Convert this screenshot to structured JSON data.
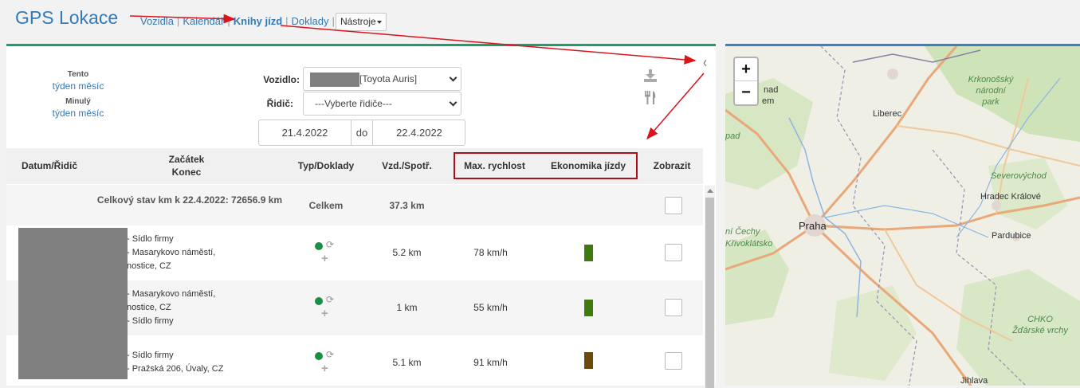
{
  "app": {
    "title": "GPS Lokace"
  },
  "nav": {
    "items": [
      {
        "label": "Vozidla"
      },
      {
        "label": "Kalendář"
      },
      {
        "label": "Knihy jízd"
      },
      {
        "label": "Doklady"
      }
    ],
    "tools_label": "Nástroje"
  },
  "period": {
    "this_label": "Tento",
    "this_links": "týden měsíc",
    "last_label": "Minulý",
    "last_links": "týden měsíc"
  },
  "filters": {
    "vehicle_label": "Vozidlo:",
    "vehicle_value": "[Toyota Auris]",
    "driver_label": "Řidič:",
    "driver_placeholder": "---Vyberte řidiče---",
    "date_from": "21.4.2022",
    "date_sep": "do",
    "date_to": "22.4.2022"
  },
  "table": {
    "headers": {
      "date_driver": "Datum/Řidič",
      "start": "Začátek",
      "end": "Konec",
      "type": "Typ/Doklady",
      "dist": "Vzd./Spotř.",
      "max_speed": "Max. rychlost",
      "economy": "Ekonomika jízdy",
      "show": "Zobrazit"
    },
    "summary": {
      "text": "Celkový stav km k 22.4.2022: 72656.9 km",
      "type": "Celkem",
      "dist": "37.3 km"
    },
    "rows": [
      {
        "addr1": "- Sídlo firmy",
        "addr2": "- Masarykovo náměstí,",
        "addr3": "nostice, CZ",
        "dist": "5.2 km",
        "speed": "78 km/h",
        "econ_color": "#3e7a0f"
      },
      {
        "addr1": "- Masarykovo náměstí,",
        "addr2": "nostice, CZ",
        "addr3": "- Sídlo firmy",
        "dist": "1 km",
        "speed": "55 km/h",
        "econ_color": "#3e7a0f"
      },
      {
        "addr1": "- Sídlo firmy",
        "addr2": "- Pražská 206, Úvaly, CZ",
        "addr3": "",
        "dist": "5.1 km",
        "speed": "91 km/h",
        "econ_color": "#6b4a0c"
      }
    ]
  },
  "map": {
    "zoom_in": "+",
    "zoom_out": "−",
    "labels": {
      "liberec": "Liberec",
      "krkonose": "Krkonošský národní park",
      "severovychod": "Severovýchod",
      "hradec": "Hradec Králové",
      "praha": "Praha",
      "pardubice": "Pardubice",
      "cechy": "ní Čechy",
      "krivoklatsko": "Křivoklátsko",
      "chko": "CHKO Žďárské vrchy",
      "jihlava": "Jihlava",
      "nad": "nad",
      "em": "em",
      "pad": "pad"
    }
  },
  "colors": {
    "accent": "#337ab7",
    "panel_top": "#1f9e6a",
    "highlight": "#b10e1c",
    "annotation": "#d9141c"
  }
}
